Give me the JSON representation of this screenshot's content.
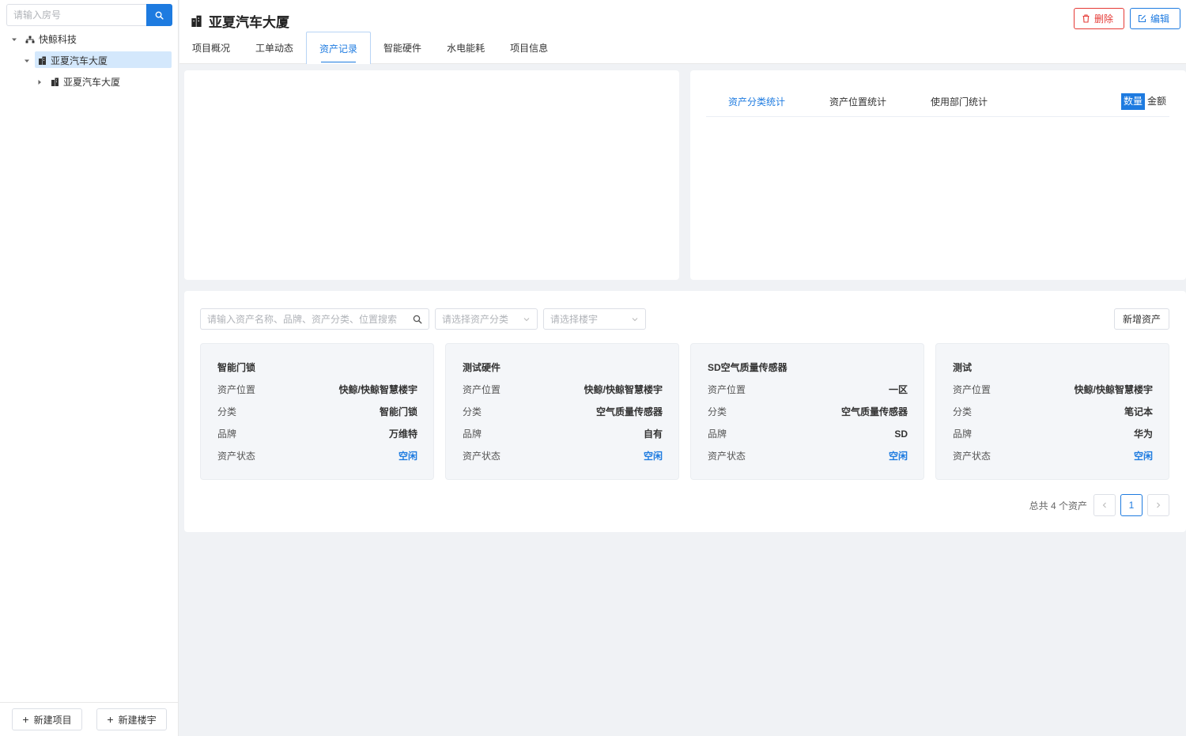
{
  "sidebar": {
    "search_placeholder": "请输入房号",
    "tree": [
      {
        "label": "快鲸科技",
        "icon": "org-icon"
      },
      {
        "label": "亚夏汽车大厦",
        "icon": "building-icon",
        "selected": true
      },
      {
        "label": "亚夏汽车大厦",
        "icon": "building-icon"
      }
    ],
    "footer": {
      "new_project": "新建项目",
      "new_building": "新建楼宇"
    }
  },
  "header": {
    "title": "亚夏汽车大厦",
    "tabs": [
      "项目概况",
      "工单动态",
      "资产记录",
      "智能硬件",
      "水电能耗",
      "项目信息"
    ],
    "active_tab": "资产记录",
    "delete_label": "删除",
    "edit_label": "编辑"
  },
  "stats": {
    "tabs": [
      "资产分类统计",
      "资产位置统计",
      "使用部门统计"
    ],
    "active_tab": "资产分类统计",
    "toggle_on": "数量",
    "toggle_off": "金额"
  },
  "assets": {
    "search_placeholder": "请输入资产名称、品牌、资产分类、位置搜索",
    "category_placeholder": "请选择资产分类",
    "building_placeholder": "请选择楼宇",
    "add_label": "新增资产",
    "field_labels": {
      "location": "资产位置",
      "category": "分类",
      "brand": "品牌",
      "status": "资产状态"
    },
    "cards": [
      {
        "name": "智能门锁",
        "location": "快鲸/快鲸智慧楼宇",
        "category": "智能门锁",
        "brand": "万维特",
        "status": "空闲"
      },
      {
        "name": "测试硬件",
        "location": "快鲸/快鲸智慧楼宇",
        "category": "空气质量传感器",
        "brand": "自有",
        "status": "空闲"
      },
      {
        "name": "SD空气质量传感器",
        "location": "一区",
        "category": "空气质量传感器",
        "brand": "SD",
        "status": "空闲"
      },
      {
        "name": "测试",
        "location": "快鲸/快鲸智慧楼宇",
        "category": "笔记本",
        "brand": "华为",
        "status": "空闲"
      }
    ],
    "pagination": {
      "total_text": "总共 4 个资产",
      "current_page": "1"
    }
  },
  "colors": {
    "primary": "#1e7be0",
    "danger": "#e53935",
    "selected_bg": "#d4e8fc",
    "page_bg": "#f0f2f5"
  }
}
